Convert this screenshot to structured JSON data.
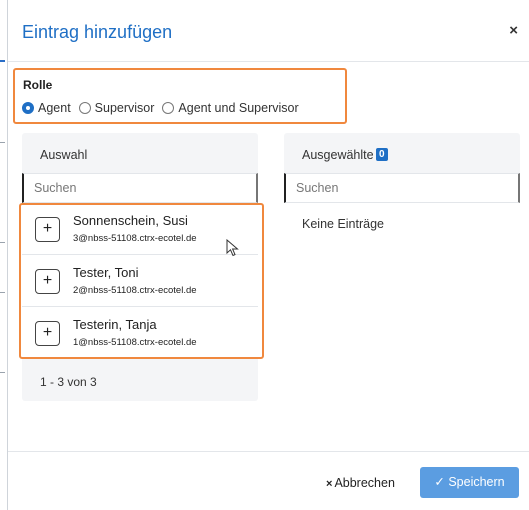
{
  "dialog": {
    "title": "Eintrag hinzufügen",
    "close_label": "×"
  },
  "role": {
    "title": "Rolle",
    "options": [
      {
        "label": "Agent",
        "selected": true
      },
      {
        "label": "Supervisor",
        "selected": false
      },
      {
        "label": "Agent und Supervisor",
        "selected": false
      }
    ]
  },
  "selection": {
    "header": "Auswahl",
    "search_placeholder": "Suchen",
    "items": [
      {
        "name": "Sonnenschein, Susi",
        "email": "3@nbss-51108.ctrx-ecotel.de",
        "add_label": "+"
      },
      {
        "name": "Tester, Toni",
        "email": "2@nbss-51108.ctrx-ecotel.de",
        "add_label": "+"
      },
      {
        "name": "Testerin, Tanja",
        "email": "1@nbss-51108.ctrx-ecotel.de",
        "add_label": "+"
      }
    ],
    "count_label": "1 - 3 von 3"
  },
  "selected": {
    "header": "Ausgewählte",
    "badge": "0",
    "search_placeholder": "Suchen",
    "empty_label": "Keine Einträge"
  },
  "footer": {
    "cancel_label": "Abbrechen",
    "cancel_icon": "×",
    "save_label": "Speichern",
    "save_icon": "✓"
  },
  "colors": {
    "accent": "#1f6fc5",
    "highlight": "#f0883e",
    "save_button": "#5b9de1"
  }
}
